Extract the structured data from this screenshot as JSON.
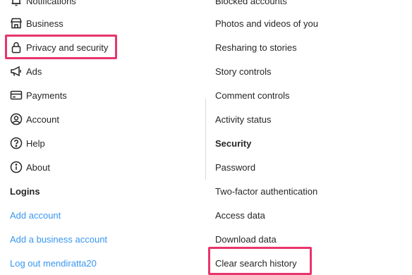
{
  "left_menu": {
    "notifications": "Notifications",
    "business": "Business",
    "privacy": "Privacy and security",
    "ads": "Ads",
    "payments": "Payments",
    "account": "Account",
    "help": "Help",
    "about": "About",
    "logins_heading": "Logins",
    "add_account": "Add account",
    "add_business": "Add a business account",
    "logout": "Log out mendiratta20"
  },
  "right_menu": {
    "blocked": "Blocked accounts",
    "photos": "Photos and videos of you",
    "resharing": "Resharing to stories",
    "story": "Story controls",
    "comment": "Comment controls",
    "activity": "Activity status",
    "security_heading": "Security",
    "password": "Password",
    "two_factor": "Two-factor authentication",
    "access": "Access data",
    "download": "Download data",
    "clear_search": "Clear search history"
  },
  "colors": {
    "highlight": "#e8356b",
    "link": "#3897f0",
    "text": "#262626"
  },
  "icons": [
    "bell-icon",
    "store-icon",
    "lock-icon",
    "megaphone-icon",
    "card-icon",
    "person-icon",
    "help-icon",
    "info-icon"
  ]
}
